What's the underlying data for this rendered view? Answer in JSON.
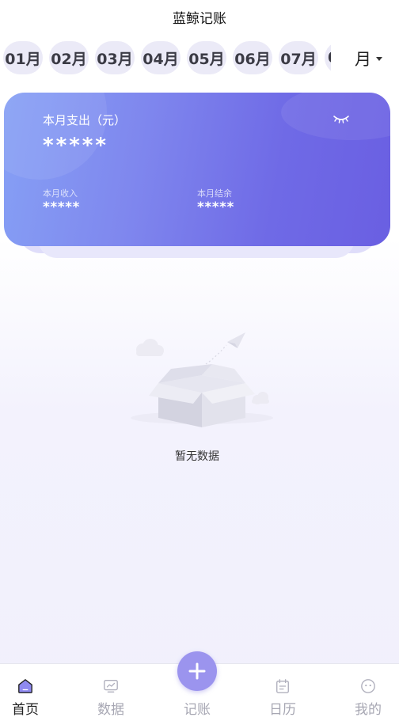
{
  "header": {
    "title": "蓝鲸记账"
  },
  "months": [
    "01月",
    "02月",
    "03月",
    "04月",
    "05月",
    "06月",
    "07月",
    "0"
  ],
  "period": {
    "selected": "月"
  },
  "summary": {
    "expense_label": "本月支出（元）",
    "expense_value": "*****",
    "income_label": "本月收入",
    "income_value": "*****",
    "balance_label": "本月结余",
    "balance_value": "*****"
  },
  "empty_state": {
    "text": "暂无数据"
  },
  "nav": {
    "home": "首页",
    "data": "数据",
    "record": "记账",
    "calendar": "日历",
    "mine": "我的"
  },
  "colors": {
    "accent": "#6f6ae6",
    "card_start": "#86a0f5",
    "card_end": "#6a5fe2",
    "chip_bg": "#ebeaf7",
    "add_button": "#9b94ee"
  }
}
